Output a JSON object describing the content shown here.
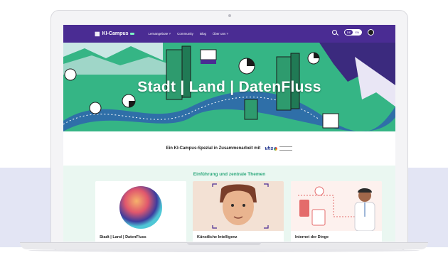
{
  "nav": {
    "logo": "KI-Campus",
    "menu": [
      "Lernangebote ˅",
      "Community",
      "Blog",
      "Über uns ˅"
    ],
    "lang": [
      "DE",
      "EN"
    ],
    "active_lang": "DE"
  },
  "hero": {
    "title": "Stadt | Land | DatenFluss"
  },
  "partner": {
    "text": "Ein KI-Campus-Spezial in Zusammenarbeit mit",
    "logo": "vhs"
  },
  "topics": {
    "heading": "Einführung und zentrale Themen",
    "cards": [
      {
        "title": "Stadt | Land | DatenFluss"
      },
      {
        "title": "Künstliche Intelligenz"
      },
      {
        "title": "Internet der Dinge"
      }
    ]
  },
  "colors": {
    "brand": "#4a2c93",
    "hero_green": "#35b585",
    "accent": "#2aa77a"
  },
  "icons": [
    "grid-logo-icon",
    "search-icon",
    "avatar-icon"
  ]
}
